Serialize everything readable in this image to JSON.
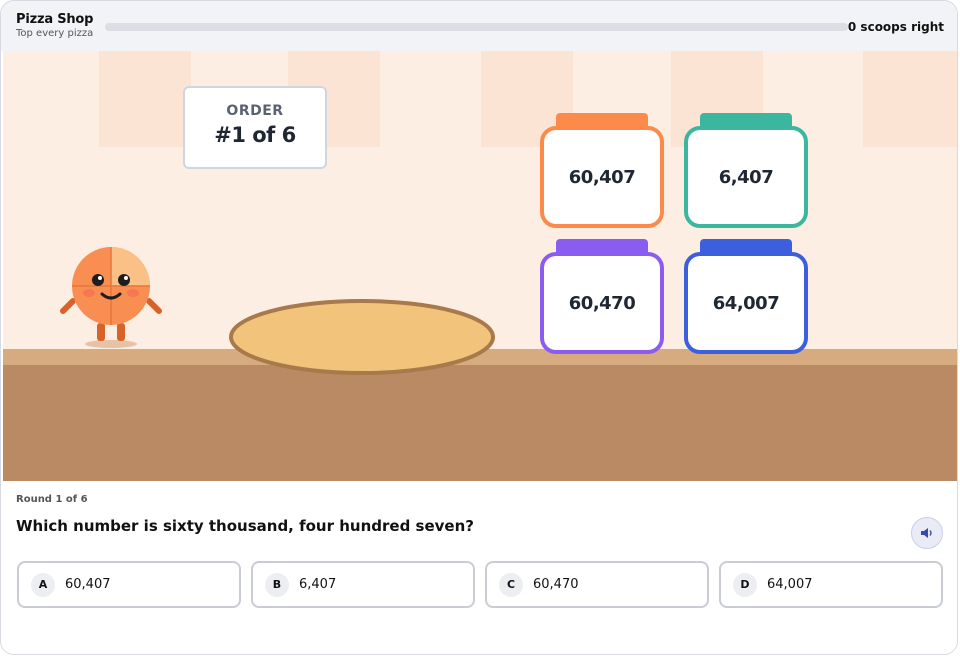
{
  "header": {
    "title": "Pizza Shop",
    "subtitle": "Top every pizza",
    "progress_fraction": 0,
    "score_text": "0 scoops right"
  },
  "scene": {
    "order_label": "ORDER",
    "order_number": "#1 of 6",
    "jars": [
      {
        "value": "60,407",
        "color": "#fb8a4b"
      },
      {
        "value": "6,407",
        "color": "#3bb79f"
      },
      {
        "value": "60,470",
        "color": "#8a5cf0"
      },
      {
        "value": "64,007",
        "color": "#3b5fdd"
      }
    ]
  },
  "question": {
    "round_text": "Round 1 of 6",
    "prompt": "Which number is sixty thousand, four hundred seven?"
  },
  "choices": [
    {
      "letter": "A",
      "label": "60,407"
    },
    {
      "letter": "B",
      "label": "6,407"
    },
    {
      "letter": "C",
      "label": "60,470"
    },
    {
      "letter": "D",
      "label": "64,007"
    }
  ],
  "icons": {
    "audio": "speaker-icon",
    "mascot": "pizza-mascot-icon",
    "pizza_base": "pizza-dough-icon"
  }
}
